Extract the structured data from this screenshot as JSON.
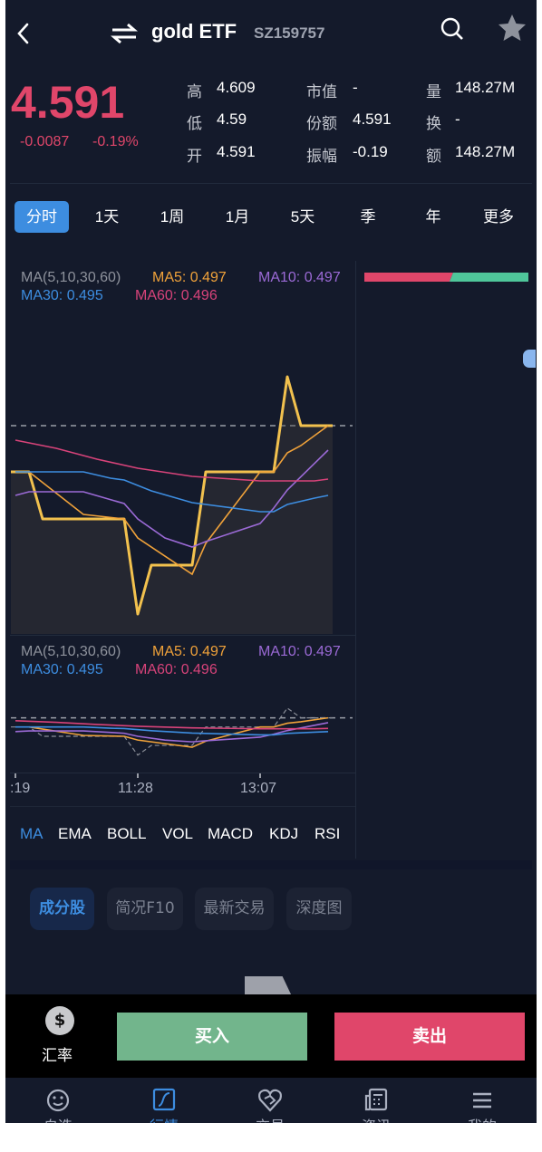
{
  "header": {
    "title": "gold ETF",
    "code": "SZ159757",
    "back_icon": "chevron-left-icon",
    "switch_icon": "swap-arrows-icon",
    "search_icon": "search-icon",
    "favorite_icon": "star-icon"
  },
  "quote": {
    "price": "4.591",
    "change": "-0.0087",
    "change_pct": "-0.19%",
    "color_down": "#e0466a",
    "stats": [
      {
        "label": "高",
        "value": "4.609"
      },
      {
        "label": "市值",
        "value": "-"
      },
      {
        "label": "量",
        "value": "148.27M"
      },
      {
        "label": "低",
        "value": "4.59"
      },
      {
        "label": "份额",
        "value": "4.591"
      },
      {
        "label": "换",
        "value": "-"
      },
      {
        "label": "开",
        "value": "4.591"
      },
      {
        "label": "振幅",
        "value": "-0.19"
      },
      {
        "label": "额",
        "value": "148.27M"
      }
    ]
  },
  "periods": [
    {
      "label": "分时",
      "active": true
    },
    {
      "label": "1天"
    },
    {
      "label": "1周"
    },
    {
      "label": "1月"
    },
    {
      "label": "5天"
    },
    {
      "label": "季"
    },
    {
      "label": "年"
    },
    {
      "label": "更多"
    }
  ],
  "ma_legend": {
    "params": "MA(5,10,30,60)",
    "ma5": "MA5: 0.497",
    "ma10": "MA10: 0.497",
    "ma30": "MA30: 0.495",
    "ma60": "MA60: 0.496"
  },
  "chart_data": {
    "type": "line",
    "reference_price": 4.591,
    "xlim": [
      0,
      71
    ],
    "ylim": [
      4.568,
      4.608
    ],
    "x_ticks": [
      {
        "x": 1,
        "label": ":19"
      },
      {
        "x": 28,
        "label": "11:28"
      },
      {
        "x": 55,
        "label": "13:07"
      }
    ],
    "colors": {
      "price": "#f2c14e",
      "ma5": "#f0a23a",
      "ma10": "#9b6ad6",
      "ma30": "#3d8de0",
      "ma60": "#d8437a"
    },
    "series": [
      {
        "key": "price",
        "x": [
          0,
          4,
          7,
          25,
          28,
          31,
          40,
          43,
          58,
          61,
          64,
          71
        ],
        "y": [
          4.5859,
          4.5859,
          4.5807,
          4.5807,
          4.5702,
          4.5756,
          4.5756,
          4.5859,
          4.5859,
          4.5964,
          4.591,
          4.591
        ]
      },
      {
        "key": "ma5",
        "x": [
          4,
          16,
          25,
          28,
          40,
          43,
          55,
          58,
          61,
          64,
          70
        ],
        "y": [
          4.5859,
          4.5812,
          4.5807,
          4.5786,
          4.5746,
          4.578,
          4.5859,
          4.5859,
          4.588,
          4.5888,
          4.591
        ]
      },
      {
        "key": "ma10",
        "x": [
          1,
          4,
          16,
          25,
          28,
          34,
          40,
          43,
          49,
          55,
          58,
          61,
          70
        ],
        "y": [
          4.5833,
          4.5837,
          4.5837,
          4.5824,
          4.5807,
          4.5786,
          4.5776,
          4.5782,
          4.5792,
          4.5802,
          4.5819,
          4.5839,
          4.5883
        ]
      },
      {
        "key": "ma30",
        "x": [
          1,
          16,
          22,
          25,
          31,
          40,
          55,
          58,
          61,
          67,
          70
        ],
        "y": [
          4.5859,
          4.5859,
          4.5852,
          4.585,
          4.5838,
          4.5825,
          4.5815,
          4.5815,
          4.5823,
          4.583,
          4.5833
        ]
      },
      {
        "key": "ma60",
        "x": [
          1,
          10,
          19,
          28,
          40,
          55,
          67,
          70
        ],
        "y": [
          4.5894,
          4.5885,
          4.5873,
          4.5863,
          4.5854,
          4.5849,
          4.5849,
          4.5851
        ]
      }
    ]
  },
  "buy_sell_ratio": {
    "buy": 0.53,
    "buy_color": "#e0466a",
    "sell_color": "#4fc69a"
  },
  "indicators": [
    {
      "label": "MA",
      "active": true
    },
    {
      "label": "EMA"
    },
    {
      "label": "BOLL"
    },
    {
      "label": "VOL"
    },
    {
      "label": "MACD"
    },
    {
      "label": "KDJ"
    },
    {
      "label": "RSI"
    }
  ],
  "chips": [
    {
      "label": "成分股",
      "active": true
    },
    {
      "label": "简况F10"
    },
    {
      "label": "最新交易"
    },
    {
      "label": "深度图"
    }
  ],
  "actions": {
    "fx_icon": "dollar-icon",
    "fx_label": "汇率",
    "buy": "买入",
    "sell": "卖出",
    "buy_color": "#72b58c",
    "sell_color": "#e0466a"
  },
  "nav": [
    {
      "label": "自选",
      "icon": "smiley-icon"
    },
    {
      "label": "行情",
      "icon": "chart-icon",
      "active": true
    },
    {
      "label": "交易",
      "icon": "heart-hand-icon"
    },
    {
      "label": "资讯",
      "icon": "news-icon"
    },
    {
      "label": "我的",
      "icon": "menu-icon"
    }
  ]
}
